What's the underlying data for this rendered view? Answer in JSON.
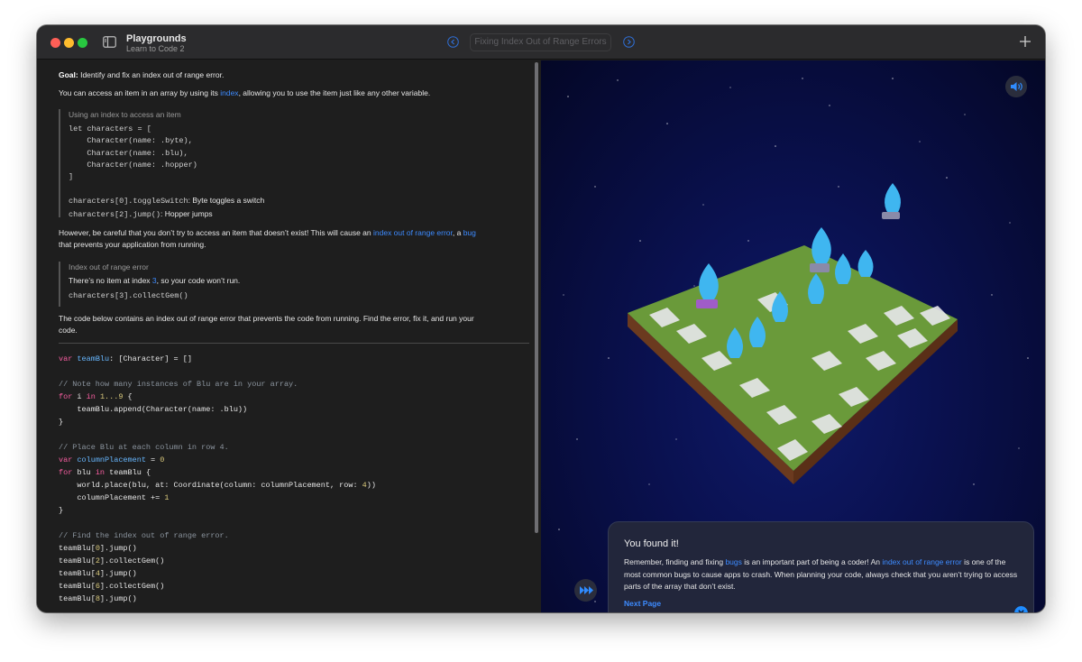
{
  "window": {
    "app_title": "Playgrounds",
    "app_subtitle": "Learn to Code 2",
    "page_title": "Fixing Index Out of Range Errors"
  },
  "lesson": {
    "goal_label": "Goal:",
    "goal_text": " Identify and fix an index out of range error.",
    "p1_before": "You can access an item in an array by using its ",
    "p1_link": "index",
    "p1_after": ", allowing you to use the item just like any other variable.",
    "callout1_title": "Using an index to access an item",
    "callout1_code": [
      "let characters = [",
      "    Character(name: .byte),",
      "    Character(name: .blu),",
      "    Character(name: .hopper)",
      "]"
    ],
    "callout1_line1_code": "characters[0].toggleSwitch",
    "callout1_line1_text": ": Byte toggles a switch",
    "callout1_line2_code": "characters[2].jump()",
    "callout1_line2_text": ": Hopper jumps",
    "p2_a": "However, be careful that you don’t try to access an item that doesn’t exist! This will cause an ",
    "p2_link1": "index out of range error",
    "p2_b": ", a ",
    "p2_link2": "bug",
    "p2_c": "that prevents your application from running.",
    "callout2_title": "Index out of range error",
    "callout2_text_a": "There’s no item at index ",
    "callout2_text_num": "3",
    "callout2_text_b": ", so your code won’t run.",
    "callout2_code": "characters[3].collectGem()",
    "p3_line1": "The code below contains an index out of range error that prevents the code from running. Find the error, fix it, and run your",
    "p3_line2": "code."
  },
  "editor": {
    "l1_kw": "var",
    "l1_var": "teamBlu",
    "l1_rest": ": [Character] = []",
    "l3_cm": "// Note how many instances of Blu are in your array.",
    "l4_kw": "for",
    "l4_a": " i ",
    "l4_kw2": "in",
    "l4_num": "1...9",
    "l4_b": " {",
    "l5": "    teamBlu.append(Character(name: .blu))",
    "l6": "}",
    "l8_cm": "// Place Blu at each column in row 4.",
    "l9_kw": "var",
    "l9_var": "columnPlacement",
    "l9_a": " = ",
    "l9_num": "0",
    "l10_kw": "for",
    "l10_a": " blu ",
    "l10_kw2": "in",
    "l10_b": " teamBlu {",
    "l11_a": "    world.place(blu, at: Coordinate(column: columnPlacement, row: ",
    "l11_num": "4",
    "l11_b": "))",
    "l12_a": "    columnPlacement += ",
    "l12_num": "1",
    "l13": "}",
    "l15_cm": "// Find the index out of range error.",
    "l16_a": "teamBlu[",
    "l16_num": "0",
    "l16_b": "].jump()",
    "l17_a": "teamBlu[",
    "l17_num": "2",
    "l17_b": "].collectGem()",
    "l18_a": "teamBlu[",
    "l18_num": "4",
    "l18_b": "].jump()",
    "l19_a": "teamBlu[",
    "l19_num": "6",
    "l19_b": "].collectGem()",
    "l20_a": "teamBlu[",
    "l20_num": "8",
    "l20_b": "].jump()"
  },
  "popup": {
    "title": "You found it!",
    "body_a": "Remember, finding and fixing ",
    "body_link1": "bugs",
    "body_b": " is an important part of being a coder! An ",
    "body_link2": "index out of range error",
    "body_c": " is one of the most common bugs to cause apps to crash. When planning your code, always check that you aren’t trying to access parts of the array that don’t exist.",
    "next_label": "Next Page"
  },
  "icons": {
    "sound": "speaker-icon",
    "fast_forward": "fast-forward-icon",
    "close": "close-icon"
  },
  "colors": {
    "link": "#3d8bff",
    "keyword": "#fc5fa3",
    "comment": "#8b949e",
    "number": "#d9c97c",
    "variable": "#67b7ff",
    "scene_bg": "#0a1150"
  }
}
